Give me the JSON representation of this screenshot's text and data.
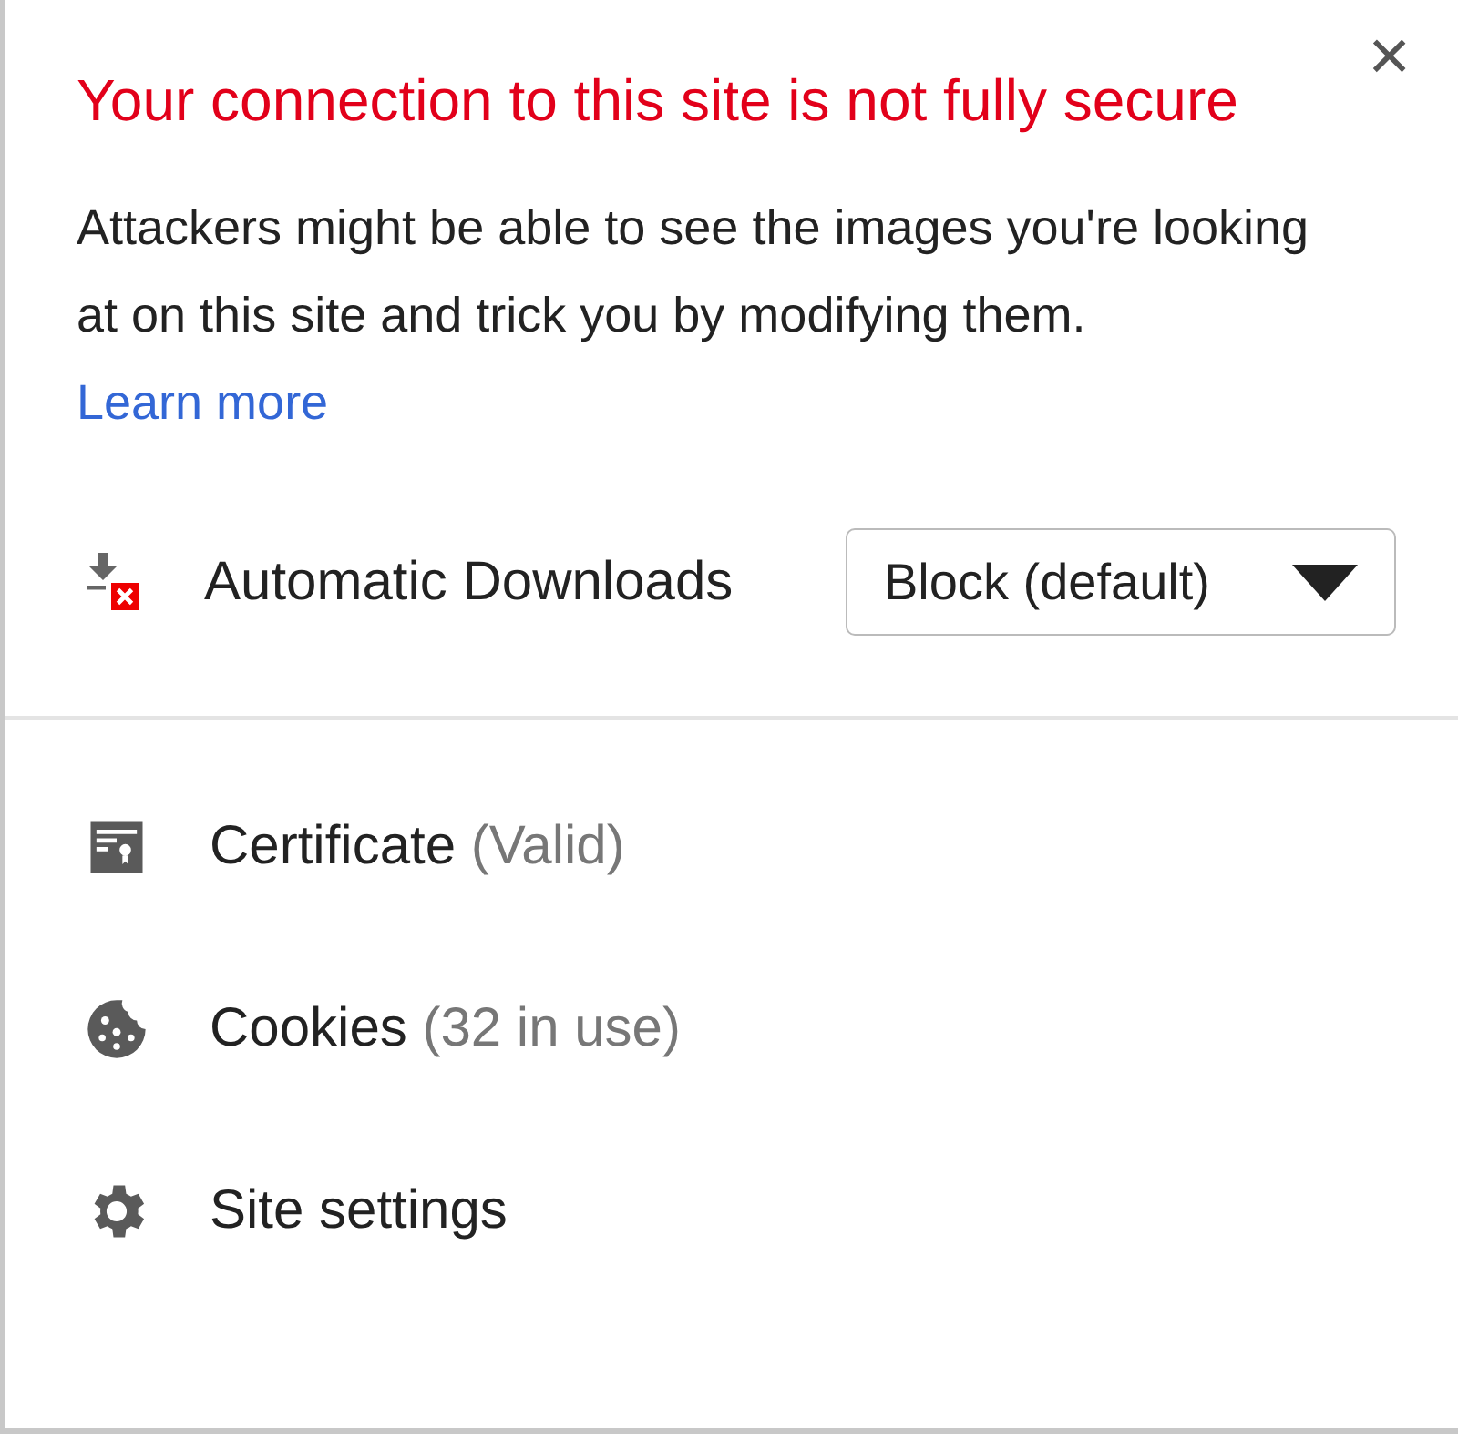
{
  "header": {
    "title": "Your connection to this site is not fully secure",
    "close": "×"
  },
  "message": {
    "text": "Attackers might be able to see the images you're looking at on this site and trick you by modifying them.",
    "link": "Learn more"
  },
  "permission": {
    "label": "Automatic Downloads",
    "value": "Block (default)"
  },
  "items": [
    {
      "kind": "certificate",
      "label": "Certificate",
      "detail": "(Valid)"
    },
    {
      "kind": "cookies",
      "label": "Cookies",
      "detail": "(32 in use)"
    },
    {
      "kind": "settings",
      "label": "Site settings"
    }
  ]
}
